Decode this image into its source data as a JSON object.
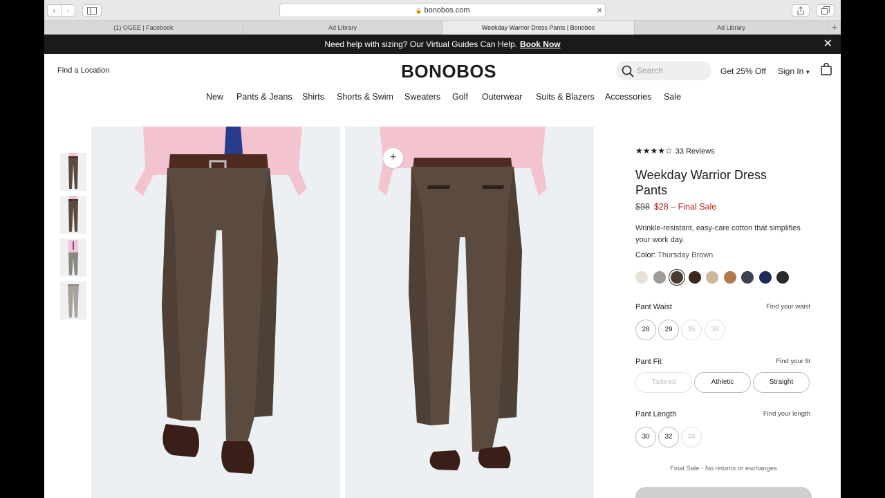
{
  "browser": {
    "url": "bonobos.com",
    "tabs": [
      {
        "title": "(1) OGEE | Facebook"
      },
      {
        "title": "Ad Library"
      },
      {
        "title": "Weekday Warrior Dress Pants | Bonobos"
      },
      {
        "title": "Ad Library"
      }
    ]
  },
  "announcement": {
    "text": "Need help with sizing? Our Virtual Guides Can Help.",
    "link": "Book Now"
  },
  "header": {
    "find_location": "Find a Location",
    "logo": "BONOBOS",
    "search_placeholder": "Search",
    "promo": "Get 25% Off",
    "sign_in": "Sign In"
  },
  "nav": [
    "New",
    "Pants & Jeans",
    "Shirts",
    "Shorts & Swim",
    "Sweaters",
    "Golf",
    "Outerwear",
    "Suits & Blazers",
    "Accessories",
    "Sale"
  ],
  "product": {
    "rating": 4.5,
    "reviews": "33 Reviews",
    "title": "Weekday Warrior Dress Pants",
    "price_original": "$98",
    "price_sale": "$28",
    "sale_label": "Final Sale",
    "description": "Wrinkle-resistant, easy-care cotton that simplifies your work day.",
    "color_label": "Color:",
    "color_value": "Thursday Brown",
    "swatches": [
      "#e6e0d6",
      "#9e9a97",
      "#4a3a30",
      "#3a2820",
      "#cbb89e",
      "#b07a4c",
      "#3e4150",
      "#1c2b5a",
      "#2a2a2c"
    ],
    "selected_swatch": 2,
    "waist": {
      "label": "Pant Waist",
      "link": "Find your waist",
      "options": [
        {
          "v": "28",
          "available": true
        },
        {
          "v": "29",
          "available": true
        },
        {
          "v": "35",
          "available": false
        },
        {
          "v": "38",
          "available": false
        }
      ]
    },
    "fit": {
      "label": "Pant Fit",
      "link": "Find your fit",
      "options": [
        {
          "v": "Tailored",
          "available": false
        },
        {
          "v": "Athletic",
          "available": true
        },
        {
          "v": "Straight",
          "available": true
        }
      ]
    },
    "length": {
      "label": "Pant Length",
      "link": "Find your length",
      "options": [
        {
          "v": "30",
          "available": true
        },
        {
          "v": "32",
          "available": true
        },
        {
          "v": "34",
          "available": false
        }
      ]
    },
    "final_note": "Final Sale - No returns or exchanges"
  },
  "colors": {
    "sale_red": "#b3261e",
    "pant_brown": "#5b4a3e",
    "shirt_pink": "#f2c6d2"
  }
}
